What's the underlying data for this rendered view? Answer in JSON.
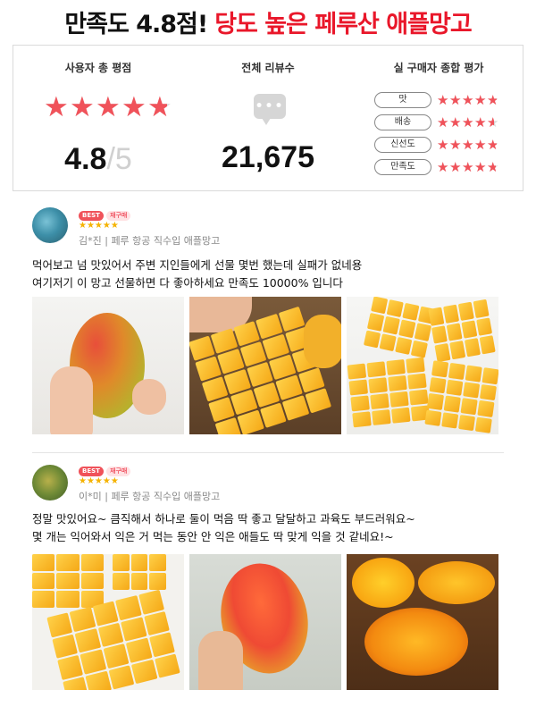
{
  "header": {
    "part1": "만족도 4.8점!",
    "part2": "당도 높은 페루산 애플망고"
  },
  "summary": {
    "rating_title": "사용자 총 평점",
    "rating_value": "4.8",
    "rating_max": "5",
    "rating_fraction": 0.96,
    "reviews_title": "전체 리뷰수",
    "reviews_count": "21,675",
    "bubble_icon": "speech-bubble-icon",
    "eval_title": "실 구매자 종합 평가",
    "categories": [
      {
        "label": "맛",
        "rating": 4.8
      },
      {
        "label": "배송",
        "rating": 4.6
      },
      {
        "label": "신선도",
        "rating": 4.8
      },
      {
        "label": "만족도",
        "rating": 4.7
      }
    ],
    "star_color": "#f0525a"
  },
  "reviews": [
    {
      "badge_best": "BEST",
      "badge_repeat": "재구매",
      "stars": "★★★★★",
      "reviewer": "김*진 | 페루 항공 직수입 애플망고",
      "line1": "먹어보고 넘 맛있어서 주변 지인들에게 선물 몇번 했는데 실패가 없네용",
      "line2": "여기저기 이 망고 선물하면 다 좋아하세요 만족도 10000% 입니다"
    },
    {
      "badge_best": "BEST",
      "badge_repeat": "재구매",
      "stars": "★★★★★",
      "reviewer": "이*미 | 페루 항공 직수입 애플망고",
      "line1": "정말 맛있어요~ 큼직해서 하나로 둘이 먹음 딱 좋고 달달하고 과육도 부드러워요~",
      "line2": "몇 개는 익어와서 익은 거 먹는 동안 안 익은 애들도 딱 맞게 익을 것 같네요!~"
    }
  ]
}
